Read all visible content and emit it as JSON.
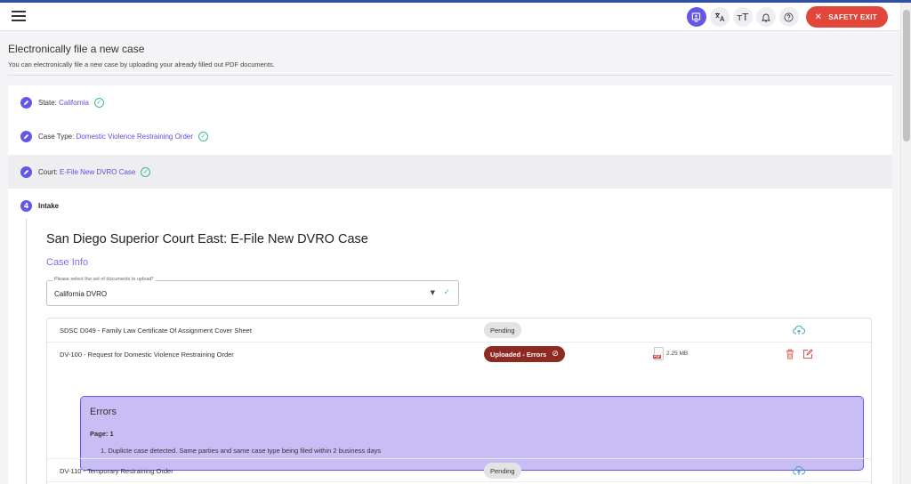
{
  "topbar": {
    "safety_exit": "SAFETY EXIT",
    "icons": [
      "menu-icon",
      "screen-reader-icon",
      "translate-icon",
      "text-size-icon",
      "bell-icon",
      "help-icon",
      "close-icon"
    ],
    "text_size_glyph": "тT",
    "help_glyph": "?"
  },
  "header": {
    "title": "Electronically file a new case",
    "subtitle": "You can electronically file a new case by uploading your already filled out PDF documents."
  },
  "steps": [
    {
      "label": "State:",
      "value": "California"
    },
    {
      "label": "Case Type:",
      "value": "Domestic Violence Restraining Order"
    },
    {
      "label": "Court:",
      "value": "E-File New DVRO Case"
    },
    {
      "number": "4",
      "label": "Intake"
    }
  ],
  "intake": {
    "court_title": "San Diego Superior Court East: E-File New DVRO Case",
    "section_title": "Case Info",
    "select_label": "Please select the set of documents to upload*",
    "select_value": "California DVRO"
  },
  "documents": [
    {
      "name": "SDSC D049 - Family Law Certificate Of Assignment Cover Sheet",
      "status": "Pending"
    },
    {
      "name": "DV-100 - Request for Domestic Violence Restraining Order",
      "status": "Uploaded - Errors",
      "file_size": "2.25 MB",
      "file_type": "PDF"
    },
    {
      "name": "DV-110 - Temporary Restraining Order",
      "status": "Pending"
    }
  ],
  "errors": {
    "title": "Errors",
    "page": "Page: 1",
    "items": [
      "1. Duplicte case detected. Same parties and same case type being filed within 2 business days"
    ]
  },
  "colors": {
    "accent": "#6257e6",
    "safety_exit": "#e2463b",
    "error_badge": "#8e2a22",
    "errors_panel": "#c9bdf5",
    "success": "#3bb89a"
  }
}
